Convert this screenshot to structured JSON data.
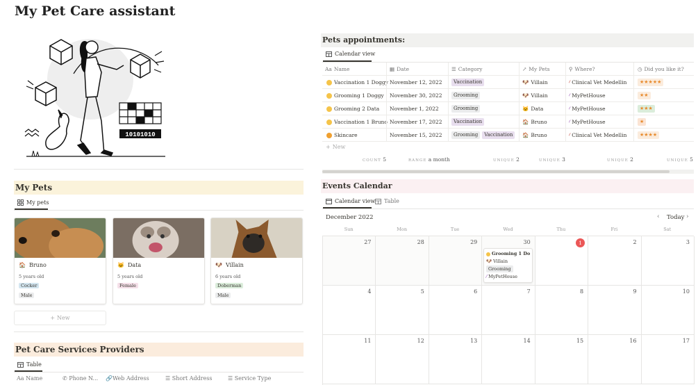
{
  "page": {
    "title": "My Pet Care assistant"
  },
  "illustration": {
    "binary_text": "10101010"
  },
  "my_pets": {
    "heading": "My Pets",
    "view_tab": "My pets",
    "new_label": "New",
    "cards": [
      {
        "name": "Bruno",
        "age": "5 years old",
        "breed": "Cocker",
        "breed_color": "#d3e5ef",
        "sex": "Male",
        "photo_colors": [
          "#b07a43",
          "#6e4a2c"
        ]
      },
      {
        "name": "Data",
        "age": "5 years old",
        "breed": "Female",
        "breed_color": "#f5e0e9",
        "sex": "",
        "photo_colors": [
          "#9a8a7e",
          "#caa07e"
        ]
      },
      {
        "name": "Villain",
        "age": "6 years old",
        "breed": "Doberman",
        "breed_color": "#dbeddb",
        "sex": "Male",
        "photo_colors": [
          "#8b5a2e",
          "#2e2a26"
        ]
      }
    ]
  },
  "providers": {
    "heading": "Pet Care Services Providers",
    "view_tab": "Table",
    "columns": [
      "Name",
      "Phone N...",
      "Web Address",
      "Short Address",
      "Service Type"
    ]
  },
  "appointments": {
    "heading": "Pets appointments:",
    "view_tab": "Calendar view",
    "columns": [
      "Name",
      "Date",
      "Category",
      "My Pets",
      "Where?",
      "Did you like it?"
    ],
    "rows": [
      {
        "name": "Vaccination 1 Doggy",
        "date": "November 12, 2022",
        "category": [
          "Vaccination"
        ],
        "pet": "Villain",
        "where": "Clinical Vet Medellin",
        "rating": "★★★★★"
      },
      {
        "name": "Grooming 1 Doggy",
        "date": "November 30, 2022",
        "category": [
          "Grooming"
        ],
        "pet": "Villain",
        "where": "MyPetHouse",
        "rating": "★★"
      },
      {
        "name": "Grooming 2 Data",
        "date": "November 1, 2022",
        "category": [
          "Grooming"
        ],
        "pet": "Data",
        "where": "MyPetHouse",
        "rating": "★★★"
      },
      {
        "name": "Vaccination 1 Bruno",
        "date": "November 17, 2022",
        "category": [
          "Vaccination"
        ],
        "pet": "Bruno",
        "where": "MyPetHouse",
        "rating": "★"
      },
      {
        "name": "Skincare",
        "date": "November 15, 2022",
        "category": [
          "Grooming",
          "Vaccination"
        ],
        "pet": "Bruno",
        "where": "Clinical Vet Medellin",
        "rating": "★★★★"
      }
    ],
    "new_label": "New",
    "footer": [
      {
        "label": "COUNT",
        "value": "5"
      },
      {
        "label": "RANGE",
        "value": "a month"
      },
      {
        "label": "UNIQUE",
        "value": "2"
      },
      {
        "label": "UNIQUE",
        "value": "3"
      },
      {
        "label": "UNIQUE",
        "value": "2"
      },
      {
        "label": "UNIQUE",
        "value": "5"
      }
    ]
  },
  "events": {
    "heading": "Events Calendar",
    "tabs": [
      "Calendar view",
      "Table"
    ],
    "month": "December 2022",
    "today_label": "Today",
    "weekdays": [
      "Sun",
      "Mon",
      "Tue",
      "Wed",
      "Thu",
      "Fri",
      "Sat"
    ],
    "weeks": [
      [
        "27",
        "28",
        "29",
        "30",
        "1",
        "2",
        "3"
      ],
      [
        "4",
        "5",
        "6",
        "7",
        "8",
        "9",
        "10"
      ],
      [
        "11",
        "12",
        "13",
        "14",
        "15",
        "16",
        "17"
      ]
    ],
    "today_day": "1",
    "event": {
      "title": "Grooming 1 Do...",
      "pet": "Villain",
      "category": "Grooming",
      "where": "MyPetHouse"
    }
  },
  "colors": {
    "my_pets_band": "#fbf3db",
    "providers_band": "#fbecdd",
    "appointments_band": "#f1f1ef",
    "events_band": "#fbf0f2",
    "vaccination_tag": "#e8deee",
    "grooming_tag": "#ebeced",
    "rating_tag": "#fbecdd",
    "today_red": "#eb5757"
  }
}
